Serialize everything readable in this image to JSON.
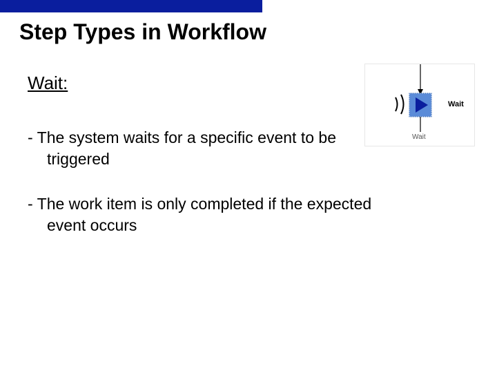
{
  "slide": {
    "title": "Step Types in Workflow",
    "section_heading": "Wait:",
    "bullets": [
      {
        "dash": "- ",
        "line1": "The system waits for a specific event to be",
        "line2": "triggered"
      },
      {
        "dash": "- ",
        "line1": "The work item is only completed if the expected",
        "line2": "event occurs"
      }
    ]
  },
  "diagram": {
    "label_right": "Wait",
    "label_bottom": "Wait",
    "colors": {
      "box_fill": "#5a8bd8",
      "box_stroke": "#2a5fb0",
      "triangle": "#0a1e9e",
      "line": "#000"
    }
  }
}
